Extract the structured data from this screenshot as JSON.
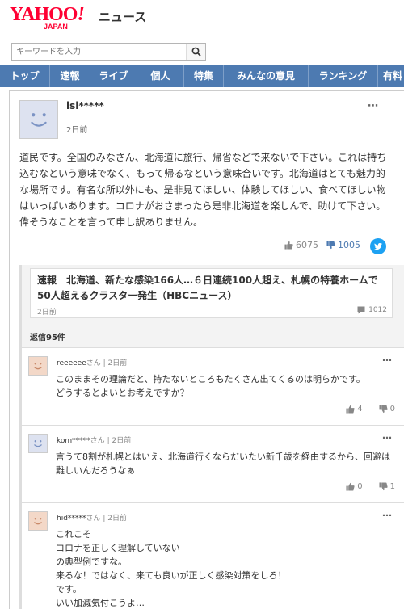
{
  "header": {
    "logo_main": "YAHOO",
    "logo_bang": "!",
    "logo_sub": "JAPAN",
    "section": "ニュース"
  },
  "search": {
    "placeholder": "キーワードを入力"
  },
  "nav": {
    "items": [
      "トップ",
      "速報",
      "ライブ",
      "個人",
      "特集",
      "みんなの意見",
      "ランキング",
      "有料"
    ]
  },
  "comment": {
    "user": "isi*****",
    "time": "2日前",
    "text": "道民です。全国のみなさん、北海道に旅行、帰省などで来ないで下さい。これは持ち込むなという意味でなく、もって帰るなという意味合いです。北海道はとても魅力的な場所です。有名な所以外にも、是非見てほしい、体験してほしい、食べてほしい物はいっぱいあります。コロナがおさまったら是非北海道を楽しんで、助けて下さい。偉そうなことを言って申し訳ありません。",
    "likes": "6075",
    "dislikes": "1005"
  },
  "article": {
    "title": "速報　北海道、新たな感染166人…６日連続100人超え、札幌の特養ホームで50人超えるクラスター発生（HBCニュース）",
    "time": "2日前",
    "comments": "1012"
  },
  "replies": {
    "count_label": "返信95件",
    "items": [
      {
        "user": "reeeeee",
        "suffix": "さん",
        "sep": "|",
        "time": "2日前",
        "text": "このままその理論だと、持たないところもたくさん出てくるのは明らかです。\nどうするとよいとお考えですか？",
        "likes": "4",
        "dislikes": "0"
      },
      {
        "user": "kom*****",
        "suffix": "さん",
        "sep": "|",
        "time": "2日前",
        "text": "言うて8割が札幌とはいえ、北海道行くならだいたい新千歳を経由するから、回避は難しいんだろうなぁ",
        "likes": "0",
        "dislikes": "1"
      },
      {
        "user": "hid*****",
        "suffix": "さん",
        "sep": "|",
        "time": "2日前",
        "text": "これこそ\nコロナを正しく理解していない\nの典型例ですな。\n来るな！ではなく、来ても良いが正しく感染対策をしろ！\nです。\nいい加減気付こうよ…\nほんと呆れる",
        "likes": "",
        "dislikes": ""
      }
    ]
  },
  "icons": {
    "more": "⋯"
  },
  "colors": {
    "nav_bg": "#4d7ab1",
    "brand_red": "#ff0033",
    "twitter": "#1da1f2"
  }
}
